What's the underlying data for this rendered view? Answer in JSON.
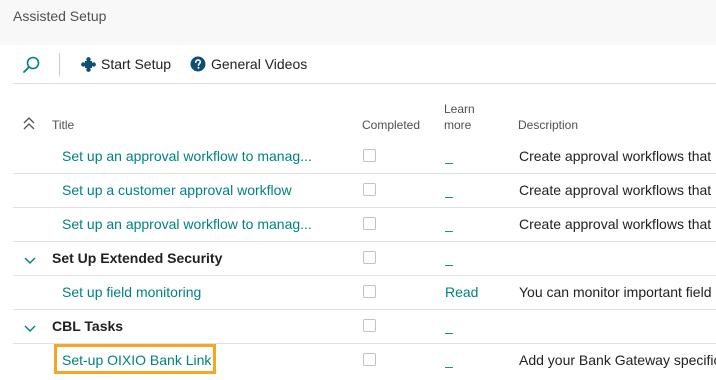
{
  "page": {
    "title": "Assisted Setup"
  },
  "toolbar": {
    "start_setup": "Start Setup",
    "general_videos": "General Videos"
  },
  "columns": {
    "title": "Title",
    "completed": "Completed",
    "learn_more_1": "Learn",
    "learn_more_2": "more",
    "description": "Description"
  },
  "rows": [
    {
      "title": "Set up an approval workflow to manag...",
      "learn": "_",
      "description": "Create approval workflows that"
    },
    {
      "title": "Set up a customer approval workflow",
      "learn": "_",
      "description": "Create approval workflows that"
    },
    {
      "title": "Set up an approval workflow to manag...",
      "learn": "_",
      "description": "Create approval workflows that"
    },
    {
      "title": "Set Up Extended Security",
      "learn": "_",
      "description": ""
    },
    {
      "title": "Set up field monitoring",
      "learn": "Read",
      "description": "You can monitor important field"
    },
    {
      "title": "CBL Tasks",
      "learn": "_",
      "description": ""
    },
    {
      "title": "Set-up OIXIO Bank Link",
      "learn": "_",
      "description": "Add your Bank Gateway specific"
    }
  ],
  "colors": {
    "link": "#00827f",
    "highlight": "#f5a623",
    "text": "#212121"
  },
  "icons": {
    "search": "search-icon",
    "start_setup": "puzzle-icon",
    "general_videos": "help-icon",
    "collapse_all": "collapse-all-icon",
    "group": "chevron-down-icon"
  }
}
